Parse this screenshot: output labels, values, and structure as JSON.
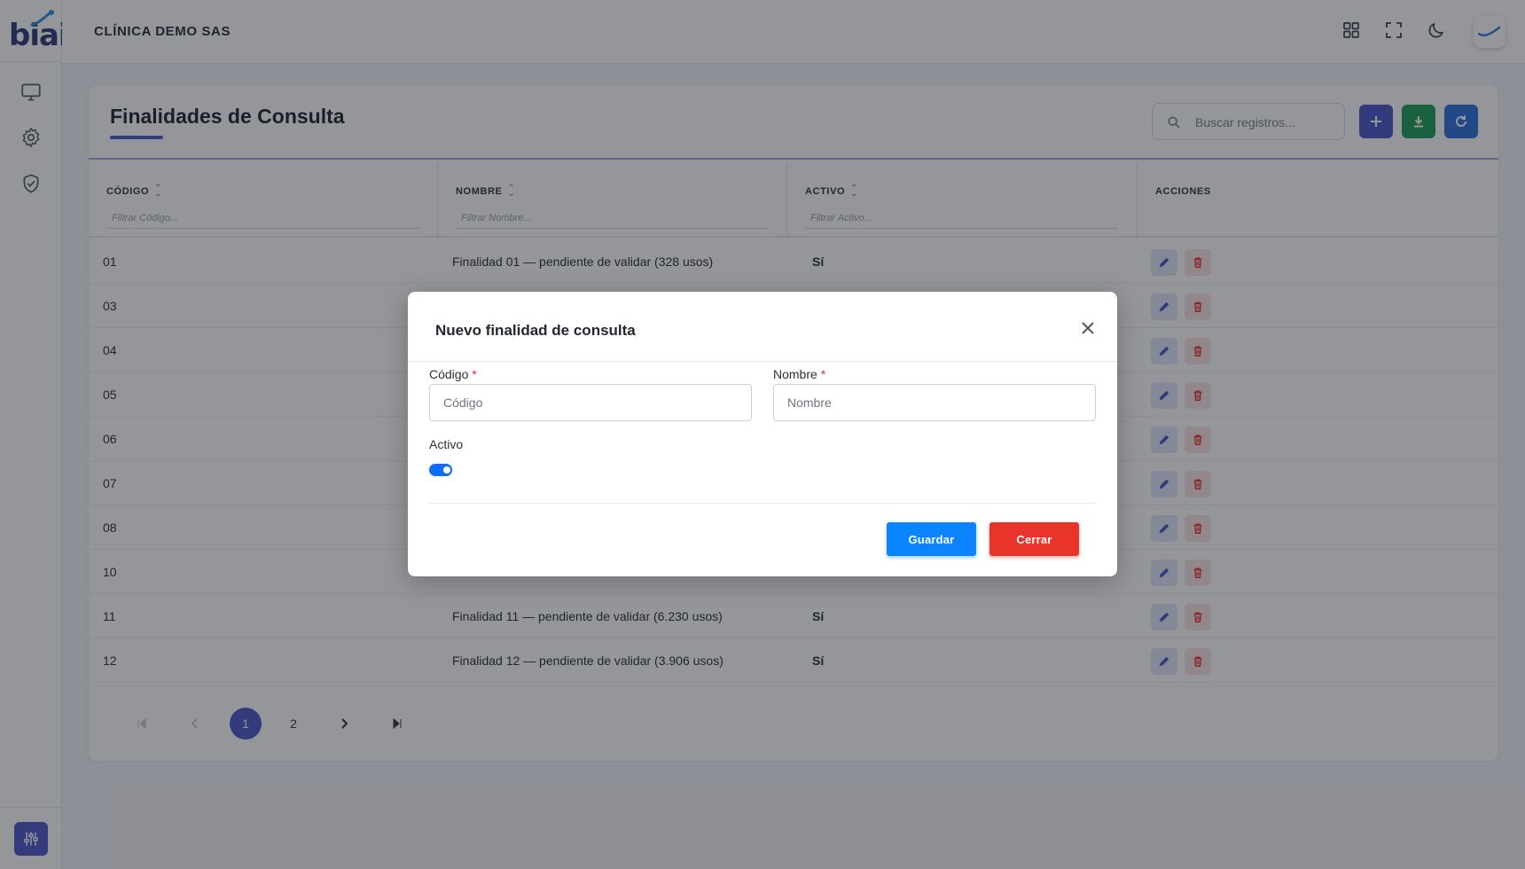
{
  "app": {
    "logo_text": "biai",
    "company": "CLÍNICA DEMO SAS"
  },
  "colors": {
    "primary": "#4c57c8",
    "success": "#1e9e5a",
    "info": "#2f6fdb",
    "danger": "#e8342a",
    "save": "#0a84ff"
  },
  "sidebar": {
    "items": [
      {
        "icon": "monitor-icon"
      },
      {
        "icon": "gear-icon"
      },
      {
        "icon": "shield-check-icon"
      }
    ],
    "bottom_icon": "sliders-icon"
  },
  "topbar": {
    "icons": [
      "grid-icon",
      "fullscreen-icon",
      "moon-icon",
      "user-avatar"
    ]
  },
  "page": {
    "title": "Finalidades de Consulta",
    "search_placeholder": "Buscar registros..."
  },
  "table": {
    "columns": [
      {
        "label": "CÓDIGO",
        "filter_placeholder": "Filtrar Código..."
      },
      {
        "label": "NOMBRE",
        "filter_placeholder": "Filtrar Nombre..."
      },
      {
        "label": "ACTIVO",
        "filter_placeholder": "Filtrar Activo..."
      },
      {
        "label": "ACCIONES"
      }
    ],
    "rows": [
      {
        "codigo": "01",
        "nombre": "Finalidad 01 — pendiente de validar (328 usos)",
        "activo": "Sí"
      },
      {
        "codigo": "03",
        "nombre": "",
        "activo": ""
      },
      {
        "codigo": "04",
        "nombre": "",
        "activo": ""
      },
      {
        "codigo": "05",
        "nombre": "",
        "activo": ""
      },
      {
        "codigo": "06",
        "nombre": "",
        "activo": ""
      },
      {
        "codigo": "07",
        "nombre": "",
        "activo": ""
      },
      {
        "codigo": "08",
        "nombre": "",
        "activo": ""
      },
      {
        "codigo": "10",
        "nombre": "",
        "activo": ""
      },
      {
        "codigo": "11",
        "nombre": "Finalidad 11 — pendiente de validar (6.230 usos)",
        "activo": "Sí"
      },
      {
        "codigo": "12",
        "nombre": "Finalidad 12 — pendiente de validar (3.906 usos)",
        "activo": "Sí"
      }
    ]
  },
  "pagination": {
    "pages": [
      "1",
      "2"
    ],
    "current": "1"
  },
  "modal": {
    "title": "Nuevo finalidad de consulta",
    "codigo_label": "Código",
    "codigo_placeholder": "Código",
    "nombre_label": "Nombre",
    "nombre_placeholder": "Nombre",
    "required_mark": "*",
    "activo_label": "Activo",
    "activo_value": true,
    "save_label": "Guardar",
    "close_label": "Cerrar"
  }
}
